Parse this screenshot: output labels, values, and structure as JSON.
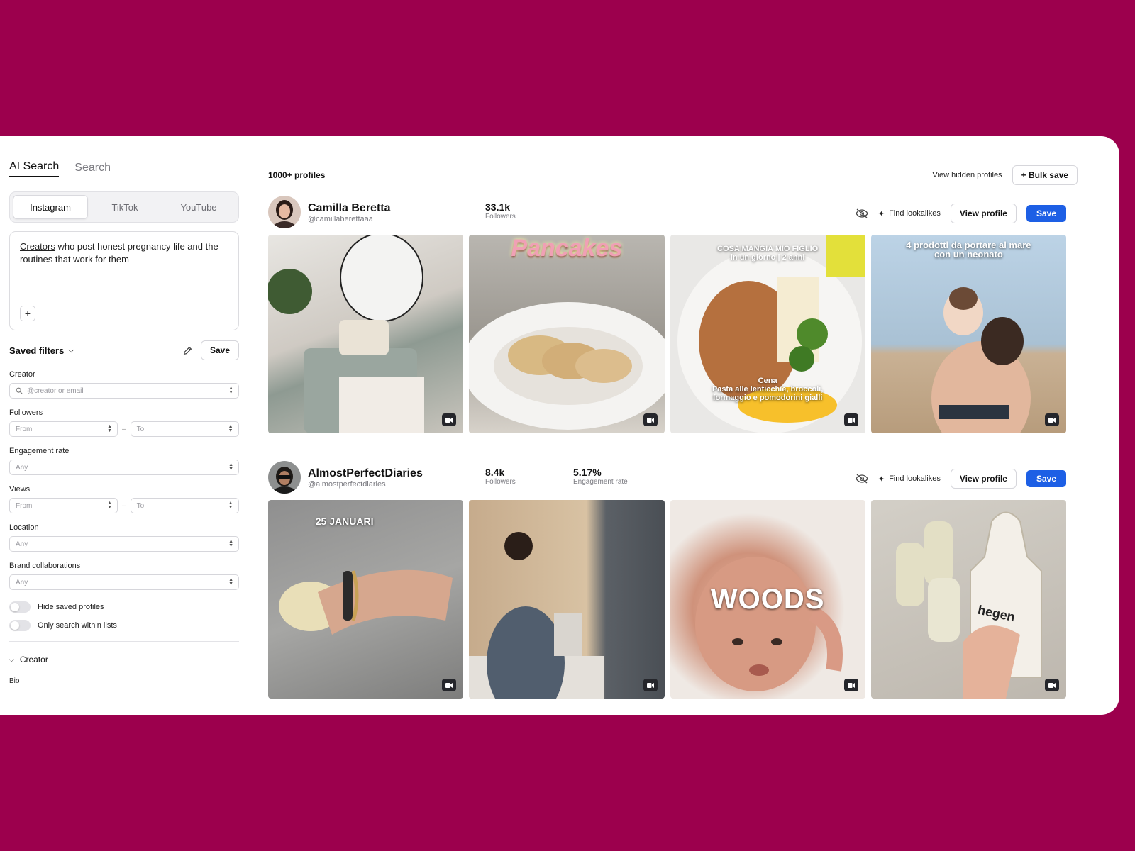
{
  "sidebar": {
    "tabs": [
      "AI Search",
      "Search"
    ],
    "platforms": [
      "Instagram",
      "TikTok",
      "YouTube"
    ],
    "query": {
      "underlined": "Creators",
      "rest": " who post honest pregnancy life and the routines that work for them"
    },
    "saved_filters_label": "Saved filters",
    "save_label": "Save",
    "creator": {
      "label": "Creator",
      "placeholder": "@creator or email"
    },
    "followers": {
      "label": "Followers",
      "from": "From",
      "to": "To"
    },
    "engagement": {
      "label": "Engagement rate",
      "value": "Any"
    },
    "views": {
      "label": "Views",
      "from": "From",
      "to": "To"
    },
    "location": {
      "label": "Location",
      "value": "Any"
    },
    "brand": {
      "label": "Brand collaborations",
      "value": "Any"
    },
    "toggles": [
      "Hide saved profiles",
      "Only search within lists"
    ],
    "section_creator": "Creator",
    "bio_label": "Bio"
  },
  "main": {
    "count": "1000+ profiles",
    "view_hidden": "View hidden profiles",
    "bulk_save": "+ Bulk save",
    "find_lookalikes": "Find lookalikes",
    "view_profile": "View profile",
    "save": "Save",
    "profiles": [
      {
        "name": "Camilla Beretta",
        "handle": "@camillaberettaaa",
        "followers": "33.1k",
        "followers_label": "Followers",
        "captions": [
          "",
          "Pancakes",
          "COSA MANGIA MIO FIGLIO in un giorno | 2 anni / Cena Pasta alle lenticchie, broccoli, formaggio e pomodorini gialli",
          "4 prodotti da portare al mare con un neonato"
        ]
      },
      {
        "name": "AlmostPerfectDiaries",
        "handle": "@almostperfectdiaries",
        "followers": "8.4k",
        "followers_label": "Followers",
        "engagement": "5.17%",
        "engagement_label": "Engagement rate",
        "captions": [
          "25 JANUARI",
          "",
          "WOODS",
          "hegen"
        ]
      }
    ]
  }
}
